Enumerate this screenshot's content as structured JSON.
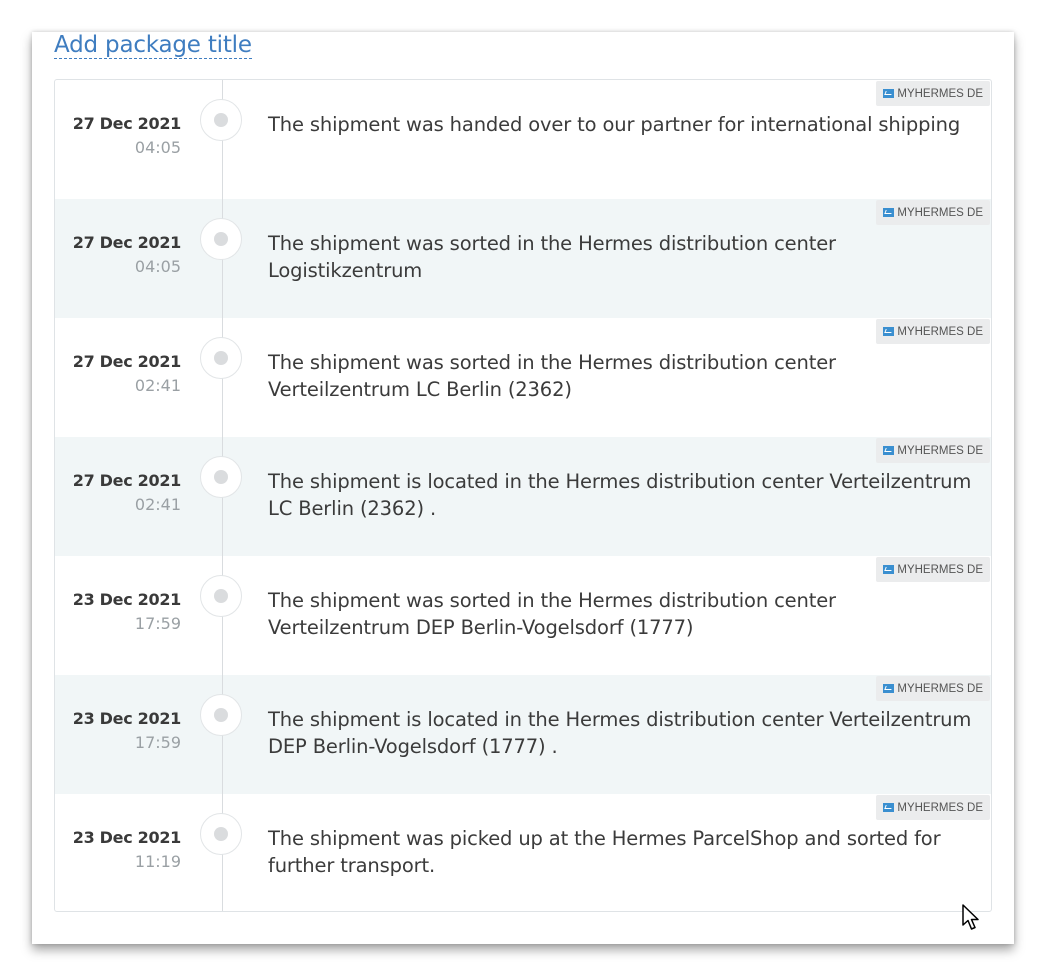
{
  "title_link": "Add package title",
  "events": [
    {
      "date": "27 Dec 2021",
      "time": "04:05",
      "description": "The shipment was handed over to our partner for international shipping",
      "source": "MYHERMES DE"
    },
    {
      "date": "27 Dec 2021",
      "time": "04:05",
      "description": "The shipment was sorted in the Hermes distribution center Logistikzentrum",
      "source": "MYHERMES DE"
    },
    {
      "date": "27 Dec 2021",
      "time": "02:41",
      "description": "The shipment was sorted in the Hermes distribution center Verteilzentrum LC Berlin (2362)",
      "source": "MYHERMES DE"
    },
    {
      "date": "27 Dec 2021",
      "time": "02:41",
      "description": "The shipment is located in the Hermes distribution center Verteilzentrum LC Berlin (2362) .",
      "source": "MYHERMES DE"
    },
    {
      "date": "23 Dec 2021",
      "time": "17:59",
      "description": "The shipment was sorted in the Hermes distribution center Verteilzentrum DEP Berlin-Vogelsdorf (1777)",
      "source": "MYHERMES DE"
    },
    {
      "date": "23 Dec 2021",
      "time": "17:59",
      "description": "The shipment is located in the Hermes distribution center Verteilzentrum DEP Berlin-Vogelsdorf (1777) .",
      "source": "MYHERMES DE"
    },
    {
      "date": "23 Dec 2021",
      "time": "11:19",
      "description": "The shipment was picked up at the Hermes ParcelShop and sorted for further transport.",
      "source": "MYHERMES DE"
    }
  ],
  "colors": {
    "link": "#3f7dc0",
    "alt_row": "#f1f6f7",
    "badge_icon": "#3a8fd0"
  }
}
